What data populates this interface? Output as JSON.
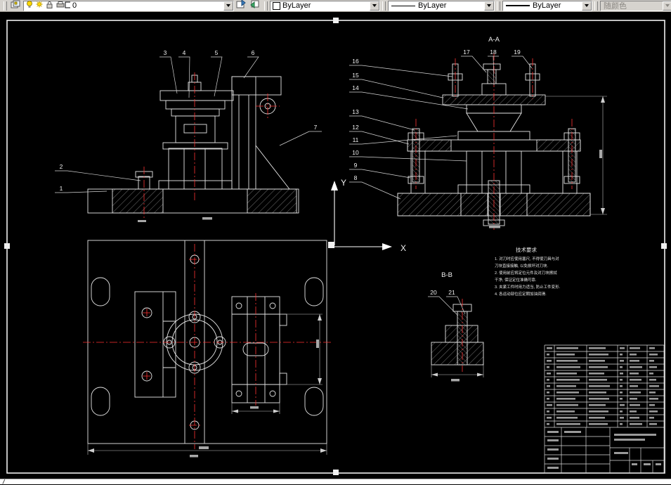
{
  "toolbar": {
    "layer_name": "0",
    "color_value": "ByLayer",
    "linetype_value": "ByLayer",
    "lineweight_value": "ByLayer",
    "plot_style_value": "随颜色"
  },
  "command_line": {
    "prompt": "/"
  },
  "drawing": {
    "section_titles": {
      "aa": "A-A",
      "bb": "B-B"
    },
    "axis": {
      "x": "X",
      "y": "Y"
    },
    "balloons": {
      "front": [
        "1",
        "2",
        "3",
        "4",
        "5",
        "6",
        "7"
      ],
      "aa_left": [
        "8",
        "9",
        "10",
        "11",
        "12",
        "13",
        "14",
        "15",
        "16"
      ],
      "aa_top": [
        "17",
        "18",
        "19"
      ],
      "bb": [
        "20",
        "21"
      ]
    },
    "notes": {
      "title": "技术要求",
      "lines": [
        "1. 对刀时应使用塞尺, 不得使刀具与对",
        "   刀块直接接触, 以免损坏对刀块.",
        "2. 使用前应将定位元件及对刀块擦拭",
        "   干净, 保证定位准确可靠.",
        "3. 夹紧工件时用力适当, 防止工件变形.",
        "4. 各运动部位应定期加油润滑."
      ]
    }
  }
}
